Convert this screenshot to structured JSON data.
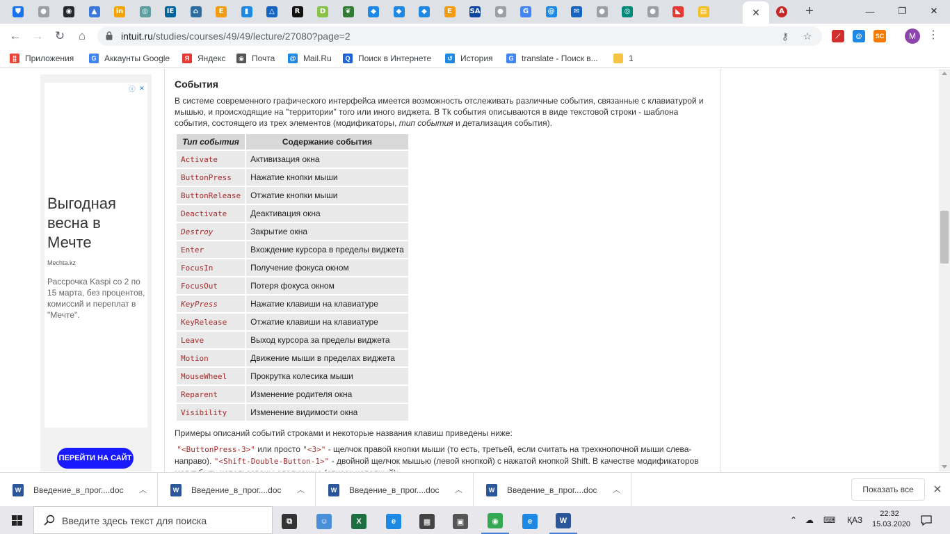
{
  "browser": {
    "tab_icons": [
      {
        "name": "shield",
        "color": "#1a73e8",
        "glyph": "⛊"
      },
      {
        "name": "gray-site",
        "color": "#9aa0a6",
        "glyph": "●"
      },
      {
        "name": "github",
        "color": "#24292e",
        "glyph": "◉"
      },
      {
        "name": "drive",
        "color": "#3c78d8",
        "glyph": "▲"
      },
      {
        "name": "in-site",
        "color": "#f4a300",
        "glyph": "in"
      },
      {
        "name": "globe",
        "color": "#5f9ea0",
        "glyph": "◎"
      },
      {
        "name": "ieee",
        "color": "#00629b",
        "glyph": "IE"
      },
      {
        "name": "home",
        "color": "#2c6ea0",
        "glyph": "⌂"
      },
      {
        "name": "e-orange",
        "color": "#f39c12",
        "glyph": "E"
      },
      {
        "name": "chart",
        "color": "#1e88e5",
        "glyph": "▮"
      },
      {
        "name": "triangle",
        "color": "#1565c0",
        "glyph": "△"
      },
      {
        "name": "r-site",
        "color": "#111111",
        "glyph": "R"
      },
      {
        "name": "d-site",
        "color": "#8bc34a",
        "glyph": "D"
      },
      {
        "name": "leaf",
        "color": "#2e7d32",
        "glyph": "❦"
      },
      {
        "name": "diamond-1",
        "color": "#1e88e5",
        "glyph": "◆"
      },
      {
        "name": "diamond-2",
        "color": "#1e88e5",
        "glyph": "◆"
      },
      {
        "name": "diamond-3",
        "color": "#1e88e5",
        "glyph": "◆"
      },
      {
        "name": "e-orange-2",
        "color": "#f39c12",
        "glyph": "E"
      },
      {
        "name": "sa-site",
        "color": "#0d47a1",
        "glyph": "SA"
      },
      {
        "name": "gray-site-2",
        "color": "#9aa0a6",
        "glyph": "●"
      },
      {
        "name": "google",
        "color": "#4285f4",
        "glyph": "G"
      },
      {
        "name": "mail-ru",
        "color": "#1e88e5",
        "glyph": "@"
      },
      {
        "name": "envelope",
        "color": "#1565c0",
        "glyph": "✉"
      },
      {
        "name": "gray-site-3",
        "color": "#9aa0a6",
        "glyph": "●"
      },
      {
        "name": "circle-green",
        "color": "#00897b",
        "glyph": "◎"
      },
      {
        "name": "gray-site-4",
        "color": "#9aa0a6",
        "glyph": "●"
      },
      {
        "name": "red-site",
        "color": "#e53935",
        "glyph": "◣"
      },
      {
        "name": "notes",
        "color": "#f6bf26",
        "glyph": "▤"
      }
    ],
    "active_tab_icon": {
      "name": "active-tab",
      "color": "#f4f4f4"
    },
    "after_tab_icon": {
      "name": "adobe-like",
      "color": "#c62828",
      "glyph": "A"
    },
    "url_host": "intuit.ru",
    "url_path": "/studies/courses/49/49/lecture/27080?page=2",
    "profile_initial": "M",
    "extensions": [
      {
        "name": "pdf-ext",
        "color": "#d32f2f",
        "glyph": "⟋"
      },
      {
        "name": "mailru-ext",
        "color": "#1e88e5",
        "glyph": "@"
      },
      {
        "name": "sc-ext",
        "color": "#f57c00",
        "glyph": "SC"
      }
    ]
  },
  "bookmarks": [
    {
      "name": "apps",
      "label": "Приложения",
      "color": "#ea4335",
      "glyph": "⣿"
    },
    {
      "name": "google-accounts",
      "label": "Аккаунты Google",
      "color": "#4285f4",
      "glyph": "G"
    },
    {
      "name": "yandex",
      "label": "Яндекс",
      "color": "#e53935",
      "glyph": "Я"
    },
    {
      "name": "mail",
      "label": "Почта",
      "color": "#555555",
      "glyph": "◉"
    },
    {
      "name": "mailru",
      "label": "Mail.Ru",
      "color": "#1e88e5",
      "glyph": "@"
    },
    {
      "name": "internet-search",
      "label": "Поиск в Интернете",
      "color": "#1e63d6",
      "glyph": "Q"
    },
    {
      "name": "history",
      "label": "История",
      "color": "#1e88e5",
      "glyph": "↺"
    },
    {
      "name": "translate",
      "label": "translate - Поиск в...",
      "color": "#4285f4",
      "glyph": "G"
    },
    {
      "name": "folder-1",
      "label": "1",
      "color": "#f6c344",
      "glyph": ""
    }
  ],
  "ad": {
    "title": "Выгодная весна в Мечте",
    "domain": "Mechta.kz",
    "body": "Рассрочка Kaspi со 2 по 15 марта, без процентов, комиссий и переплат в \"Мечте\".",
    "button": "ПЕРЕЙТИ НА САЙТ"
  },
  "article": {
    "section_title": "События",
    "intro_part1": "В системе современного графического интерфейса имеется возможность отслеживать различные события, связанные с клавиатурой и мышью, и происходящие на \"территории\" того или иного виджета. В Tk события описываются в виде текстовой строки - шаблона события, состоящего из трех элементов (модификаторы, ",
    "intro_italic": "тип события",
    "intro_part2": " и детализация события).",
    "table_headers": [
      "Тип события",
      "Содержание события"
    ],
    "events": [
      {
        "type": "Activate",
        "desc": "Активизация окна",
        "italic": false
      },
      {
        "type": "ButtonPress",
        "desc": "Нажатие кнопки мыши",
        "italic": false
      },
      {
        "type": "ButtonRelease",
        "desc": "Отжатие кнопки мыши",
        "italic": false
      },
      {
        "type": "Deactivate",
        "desc": "Деактивация окна",
        "italic": false
      },
      {
        "type": "Destroy",
        "desc": "Закрытие окна",
        "italic": true
      },
      {
        "type": "Enter",
        "desc": "Вхождение курсора в пределы виджета",
        "italic": false
      },
      {
        "type": "FocusIn",
        "desc": "Получение фокуса окном",
        "italic": false
      },
      {
        "type": "FocusOut",
        "desc": "Потеря фокуса окном",
        "italic": false
      },
      {
        "type": "KeyPress",
        "desc": "Нажатие клавиши на клавиатуре",
        "italic": true
      },
      {
        "type": "KeyRelease",
        "desc": "Отжатие клавиши на клавиатуре",
        "italic": false
      },
      {
        "type": "Leave",
        "desc": "Выход курсора за пределы виджета",
        "italic": false
      },
      {
        "type": "Motion",
        "desc": "Движение мыши в пределах виджета",
        "italic": false
      },
      {
        "type": "MouseWheel",
        "desc": "Прокрутка колесика мыши",
        "italic": false
      },
      {
        "type": "Reparent",
        "desc": "Изменение родителя окна",
        "italic": false
      },
      {
        "type": "Visibility",
        "desc": "Изменение видимости окна",
        "italic": false
      }
    ],
    "examples_intro": "Примеры описаний событий строками и некоторые названия клавиш приведены ниже:",
    "ex_code1": "\"<ButtonPress-3>\"",
    "ex_text1": " или просто ",
    "ex_code2": "\"<3>\"",
    "ex_text2": " - щелчок правой кнопки мыши (то есть, третьей, если считать на трехкнопочной мыши слева-направо). ",
    "ex_code3": "\"<Shift-Double-Button-1>\"",
    "ex_text3": " - двойной щелчок мышью (левой кнопкой) с нажатой кнопкой Shift. В качестве модификаторов могут быть использованы следующие (список неполный):"
  },
  "downloads": {
    "items": [
      "Введение_в_прог....doc",
      "Введение_в_прог....doc",
      "Введение_в_прог....doc",
      "Введение_в_прог....doc"
    ],
    "show_all": "Показать все"
  },
  "taskbar": {
    "search_placeholder": "Введите здесь текст для поиска",
    "apps": [
      {
        "name": "task-view",
        "color": "#333333",
        "glyph": "⧉"
      },
      {
        "name": "people",
        "color": "#4a90d9",
        "glyph": "☺"
      },
      {
        "name": "excel",
        "color": "#1d6f42",
        "glyph": "X"
      },
      {
        "name": "edge",
        "color": "#1e88e5",
        "glyph": "e"
      },
      {
        "name": "calculator",
        "color": "#444444",
        "glyph": "▦"
      },
      {
        "name": "store",
        "color": "#555555",
        "glyph": "▣"
      },
      {
        "name": "chrome",
        "color": "#34a853",
        "glyph": "◉"
      },
      {
        "name": "ie",
        "color": "#1e88e5",
        "glyph": "e"
      },
      {
        "name": "word",
        "color": "#2b579a",
        "glyph": "W"
      }
    ],
    "lang": "ҚАЗ",
    "time": "22:32",
    "date": "15.03.2020"
  }
}
